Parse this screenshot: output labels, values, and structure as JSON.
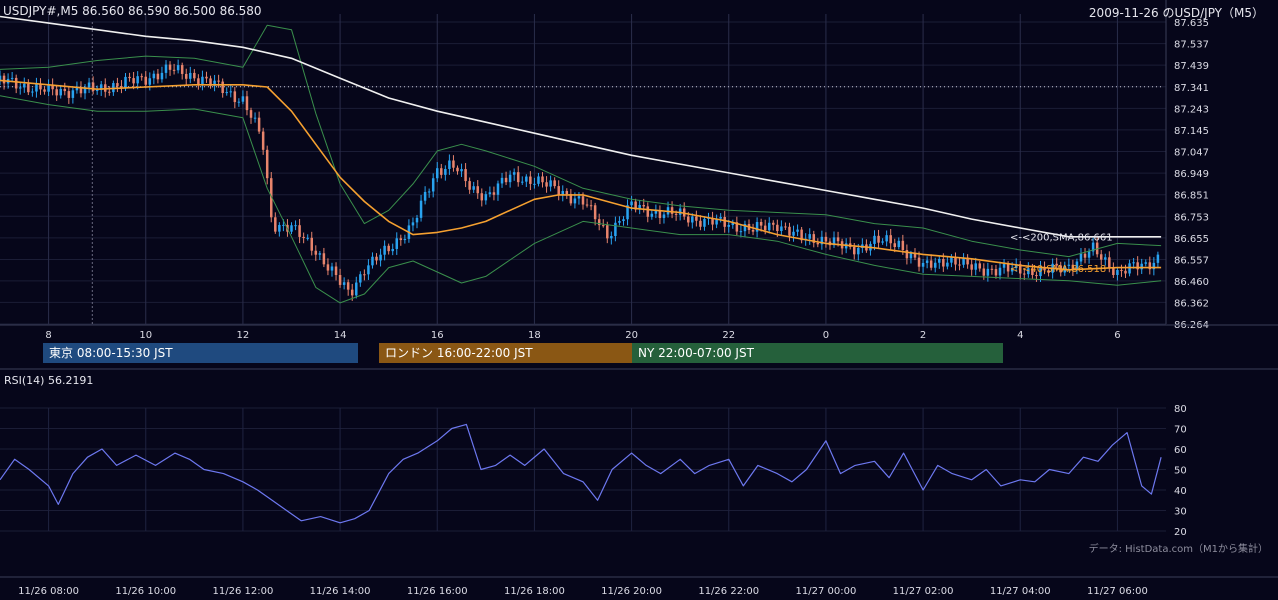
{
  "header": {
    "symbol_ohlc": "USDJPY#,M5 86.560 86.590 86.500 86.580",
    "title": "2009-11-26 のUSD/JPY（M5）"
  },
  "sessions": [
    {
      "label": "東京 08:00-15:30 JST",
      "color": "#1f4a7f"
    },
    {
      "label": "ロンドン 16:00-22:00 JST",
      "color": "#8a5714"
    },
    {
      "label": "NY 22:00-07:00 JST",
      "color": "#25603b"
    }
  ],
  "rsi_title": "RSI(14) 56.2191",
  "source": "データ: HistData.com（M1から集計）",
  "colors": {
    "background": "#06061a",
    "up": "#29a3f0",
    "down": "#e8846c",
    "sma40": "#f5a030",
    "sma200": "#f0f0f0",
    "bollinger": "#3a8f4c",
    "rsi": "#6d78f0"
  },
  "chart_data": [
    {
      "type": "line",
      "chart": "candlestick price with moving averages and Bollinger bands",
      "y_ticks": [
        "87.635",
        "87.537",
        "87.439",
        "87.341",
        "87.243",
        "87.145",
        "87.047",
        "86.949",
        "86.851",
        "86.753",
        "86.655",
        "86.557",
        "86.460",
        "86.362",
        "86.264"
      ],
      "ylim": [
        86.264,
        87.635
      ],
      "x_ticks": [
        "8",
        "10",
        "12",
        "14",
        "16",
        "18",
        "20",
        "22",
        "0",
        "2",
        "4",
        "6"
      ],
      "x_hours": [
        8,
        10,
        12,
        14,
        16,
        18,
        20,
        22,
        24,
        26,
        28,
        30
      ],
      "xlim": [
        7,
        31
      ],
      "grid": true,
      "reference_line": 87.341,
      "series": [
        {
          "name": "200,SMA",
          "label": "<-<200,SMA,86.661",
          "last": 86.661,
          "x": [
            7,
            8,
            9,
            10,
            11,
            12,
            13,
            14,
            15,
            16,
            17,
            18,
            19,
            20,
            21,
            22,
            23,
            24,
            25,
            26,
            27,
            28,
            29,
            29.5,
            30,
            30.9
          ],
          "values": [
            87.66,
            87.63,
            87.6,
            87.57,
            87.55,
            87.52,
            87.47,
            87.38,
            87.29,
            87.23,
            87.18,
            87.13,
            87.08,
            87.03,
            86.99,
            86.95,
            86.91,
            86.87,
            86.83,
            86.79,
            86.74,
            86.7,
            86.66,
            86.66,
            86.66,
            86.66
          ]
        },
        {
          "name": "40,SMA",
          "label": "<-<40,SMA,86.518",
          "last": 86.518,
          "x": [
            7,
            8,
            9,
            10,
            11,
            12,
            12.5,
            13,
            13.5,
            14,
            14.5,
            15,
            15.5,
            16,
            16.5,
            17,
            17.5,
            18,
            18.5,
            19,
            19.5,
            20,
            20.5,
            21,
            22,
            23,
            24,
            25,
            26,
            27,
            28,
            29,
            30,
            30.9
          ],
          "values": [
            87.37,
            87.35,
            87.33,
            87.34,
            87.35,
            87.35,
            87.34,
            87.23,
            87.08,
            86.93,
            86.82,
            86.73,
            86.67,
            86.68,
            86.7,
            86.73,
            86.78,
            86.83,
            86.85,
            86.85,
            86.82,
            86.79,
            86.78,
            86.77,
            86.73,
            86.67,
            86.63,
            86.61,
            86.58,
            86.56,
            86.53,
            86.51,
            86.52,
            86.52
          ]
        },
        {
          "name": "BB upper",
          "x": [
            7,
            8,
            9,
            10,
            11,
            12,
            12.5,
            13,
            13.5,
            14,
            14.5,
            15,
            15.5,
            16,
            16.5,
            17,
            18,
            19,
            20,
            21,
            22,
            23,
            24,
            25,
            26,
            27,
            28,
            29,
            30,
            30.9
          ],
          "values": [
            87.42,
            87.43,
            87.46,
            87.48,
            87.47,
            87.43,
            87.62,
            87.6,
            87.22,
            86.9,
            86.72,
            86.78,
            86.9,
            87.05,
            87.08,
            87.05,
            86.98,
            86.88,
            86.83,
            86.8,
            86.78,
            86.77,
            86.76,
            86.72,
            86.7,
            86.64,
            86.6,
            86.57,
            86.63,
            86.62
          ]
        },
        {
          "name": "BB lower",
          "x": [
            7,
            8,
            9,
            10,
            11,
            12,
            12.5,
            13,
            13.5,
            14,
            14.5,
            15,
            15.5,
            16,
            16.5,
            17,
            18,
            19,
            20,
            21,
            22,
            23,
            24,
            25,
            26,
            27,
            28,
            29,
            30,
            30.9
          ],
          "values": [
            87.3,
            87.26,
            87.23,
            87.23,
            87.24,
            87.2,
            86.88,
            86.66,
            86.43,
            86.36,
            86.4,
            86.52,
            86.55,
            86.5,
            86.45,
            86.48,
            86.63,
            86.73,
            86.7,
            86.67,
            86.67,
            86.64,
            86.58,
            86.53,
            86.49,
            86.48,
            86.47,
            86.46,
            86.44,
            86.46
          ]
        }
      ],
      "candles_close_path": {
        "x": [
          7,
          8,
          9,
          10,
          10.5,
          11,
          11.5,
          12,
          12.4,
          12.6,
          13,
          13.5,
          14,
          14.2,
          14.5,
          15,
          15.5,
          16,
          16.3,
          16.7,
          17,
          17.5,
          18,
          18.5,
          19,
          19.5,
          20,
          20.5,
          21,
          21.5,
          22,
          22.5,
          23,
          23.5,
          24,
          24.5,
          25,
          25.5,
          26,
          26.5,
          27,
          27.5,
          28,
          28.5,
          29,
          29.5,
          30,
          30.3,
          30.6,
          30.9
        ],
        "values": [
          87.37,
          87.32,
          87.33,
          87.38,
          87.42,
          87.39,
          87.34,
          87.28,
          87.1,
          86.72,
          86.7,
          86.6,
          86.45,
          86.4,
          86.52,
          86.6,
          86.72,
          86.96,
          87.0,
          86.87,
          86.85,
          86.93,
          86.92,
          86.87,
          86.82,
          86.67,
          86.8,
          86.77,
          86.76,
          86.73,
          86.72,
          86.69,
          86.72,
          86.65,
          86.65,
          86.6,
          86.64,
          86.63,
          86.52,
          86.56,
          86.52,
          86.51,
          86.51,
          86.5,
          86.53,
          86.6,
          86.5,
          86.52,
          86.53,
          86.58
        ]
      }
    },
    {
      "type": "line",
      "chart": "RSI oscillator",
      "title": "RSI(14) 56.2191",
      "y_ticks": [
        "80",
        "70",
        "60",
        "50",
        "40",
        "30",
        "20"
      ],
      "ylim": [
        20,
        80
      ],
      "x_ticks": [
        "11/26 08:00",
        "11/26 10:00",
        "11/26 12:00",
        "11/26 14:00",
        "11/26 16:00",
        "11/26 18:00",
        "11/26 20:00",
        "11/26 22:00",
        "11/27 00:00",
        "11/27 02:00",
        "11/27 04:00",
        "11/27 06:00"
      ],
      "x_hours": [
        8,
        10,
        12,
        14,
        16,
        18,
        20,
        22,
        24,
        26,
        28,
        30
      ],
      "xlim": [
        7,
        31
      ],
      "grid": true,
      "series": [
        {
          "name": "RSI(14)",
          "x": [
            7,
            7.3,
            7.6,
            8,
            8.2,
            8.5,
            8.8,
            9.1,
            9.4,
            9.8,
            10.2,
            10.6,
            10.9,
            11.2,
            11.6,
            12,
            12.3,
            12.6,
            12.9,
            13.2,
            13.6,
            14,
            14.3,
            14.6,
            15,
            15.3,
            15.6,
            16,
            16.3,
            16.6,
            16.9,
            17.2,
            17.5,
            17.8,
            18.2,
            18.6,
            19,
            19.3,
            19.6,
            20,
            20.3,
            20.6,
            21,
            21.3,
            21.6,
            22,
            22.3,
            22.6,
            23,
            23.3,
            23.6,
            24,
            24.3,
            24.6,
            25,
            25.3,
            25.6,
            26,
            26.3,
            26.6,
            27,
            27.3,
            27.6,
            28,
            28.3,
            28.6,
            29,
            29.3,
            29.6,
            29.9,
            30.2,
            30.5,
            30.7,
            30.9
          ],
          "values": [
            45,
            55,
            50,
            42,
            33,
            48,
            56,
            60,
            52,
            57,
            52,
            58,
            55,
            50,
            48,
            44,
            40,
            35,
            30,
            25,
            27,
            24,
            26,
            30,
            48,
            55,
            58,
            64,
            70,
            72,
            50,
            52,
            57,
            52,
            60,
            48,
            44,
            35,
            50,
            58,
            52,
            48,
            55,
            48,
            52,
            55,
            42,
            52,
            48,
            44,
            50,
            64,
            48,
            52,
            54,
            46,
            58,
            40,
            52,
            48,
            45,
            50,
            42,
            45,
            44,
            50,
            48,
            56,
            54,
            62,
            68,
            42,
            38,
            56
          ]
        }
      ]
    }
  ]
}
